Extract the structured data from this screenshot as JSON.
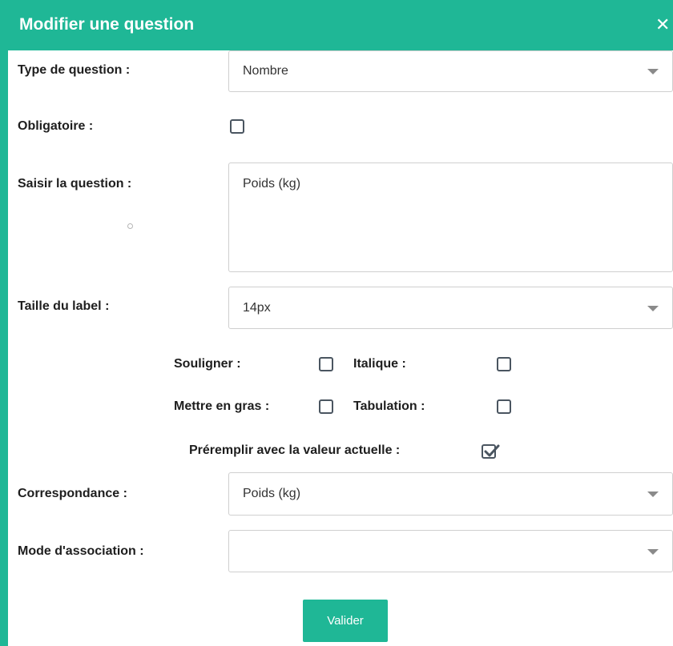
{
  "dialog": {
    "title": "Modifier une question",
    "close_symbol": "✕"
  },
  "form": {
    "question_type": {
      "label": "Type de question :",
      "value": "Nombre"
    },
    "required": {
      "label": "Obligatoire :",
      "checked": false
    },
    "question_text": {
      "label": "Saisir la question :",
      "value": "Poids (kg)"
    },
    "label_size": {
      "label": "Taille du label :",
      "value": "14px"
    },
    "underline": {
      "label": "Souligner :",
      "checked": false
    },
    "italic": {
      "label": "Italique :",
      "checked": false
    },
    "bold": {
      "label": "Mettre en gras :",
      "checked": false
    },
    "tab": {
      "label": "Tabulation :",
      "checked": false
    },
    "prefill": {
      "label": "Préremplir avec la valeur actuelle :",
      "checked": true
    },
    "mapping": {
      "label": "Correspondance :",
      "value": "Poids (kg)"
    },
    "association_mode": {
      "label": "Mode d'association :",
      "value": ""
    }
  },
  "submit_label": "Valider",
  "colors": {
    "accent": "#1fb796",
    "checkbox_border": "#4a5560"
  },
  "icons": [
    "close-icon",
    "chevron-down-icon",
    "checkmark-icon"
  ]
}
